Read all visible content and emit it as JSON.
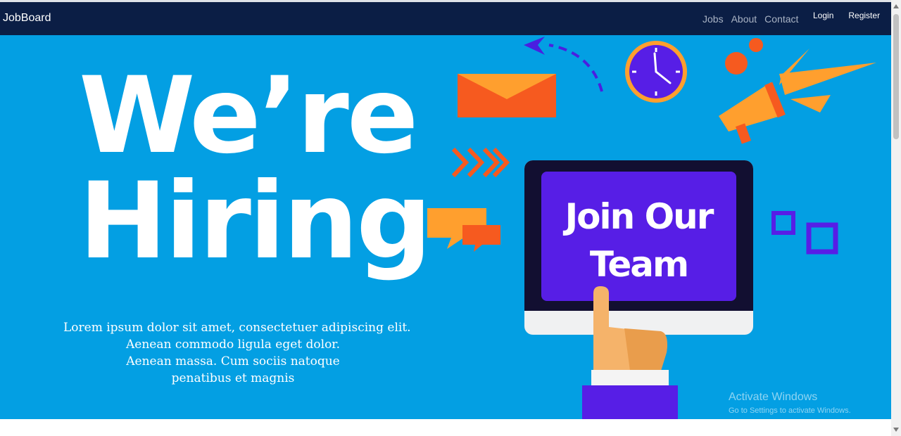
{
  "navbar": {
    "brand": "JobBoard",
    "links": [
      "Jobs",
      "About",
      "Contact"
    ],
    "auth": {
      "login": "Login",
      "register": "Register"
    }
  },
  "hero": {
    "title_line1": "We’re",
    "title_line2": "Hiring",
    "description_lines": [
      "Lorem ipsum dolor sit amet, consectetuer adipiscing elit.",
      "Aenean commodo ligula eget dolor.",
      "Aenean massa. Cum sociis natoque",
      "penatibus et magnis"
    ],
    "screen_line1": "Join Our",
    "screen_line2": "Team"
  },
  "watermark": {
    "line1": "Activate Windows",
    "line2": "Go to Settings to activate Windows."
  },
  "colors": {
    "navbar_bg": "#0b1e45",
    "hero_bg": "#039fe3",
    "accent_purple": "#571ee6",
    "accent_orange": "#ff9f2e",
    "accent_red_orange": "#f65a1f"
  },
  "icons": [
    "envelope-icon",
    "clock-icon",
    "megaphone-icon",
    "chevrons-icon",
    "chat-bubbles-icon",
    "squares-icon",
    "dashed-arrow-icon",
    "pointing-hand-icon"
  ]
}
